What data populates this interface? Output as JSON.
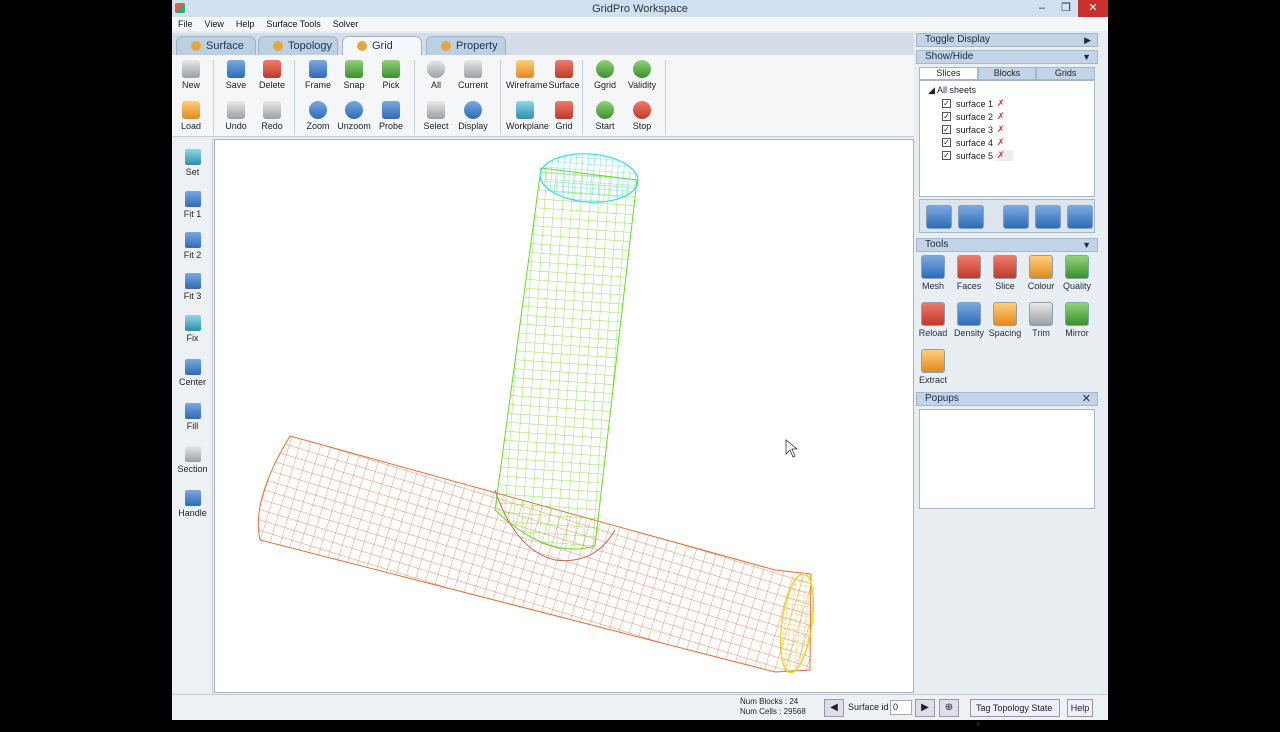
{
  "window": {
    "title": "GridPro Workspace"
  },
  "menubar": [
    "File",
    "View",
    "Help",
    "Surface Tools",
    "Solver"
  ],
  "tabs": [
    "Surface",
    "Topology",
    "Grid",
    "Property"
  ],
  "ribbon": {
    "new": "New",
    "save": "Save",
    "delete": "Delete",
    "frame": "Frame",
    "snap": "Snap",
    "pick": "Pick",
    "all": "All",
    "current": "Current",
    "wireframe": "Wireframe",
    "surface": "Surface",
    "ggrid": "Ggrid",
    "validity": "Validity",
    "load": "Load",
    "undo": "Undo",
    "redo": "Redo",
    "zoom": "Zoom",
    "unzoom": "Unzoom",
    "probe": "Probe",
    "select": "Select",
    "display": "Display",
    "workplane": "Workplane",
    "grid": "Grid",
    "start": "Start",
    "stop": "Stop"
  },
  "lefttools": [
    "Set",
    "Fit 1",
    "Fit 2",
    "Fit 3",
    "Fix",
    "Center",
    "Fill",
    "Section",
    "Handle"
  ],
  "rpanel": {
    "toggle_display": "Toggle Display",
    "show_hide": "Show/Hide",
    "subtabs": [
      "Slices",
      "Blocks",
      "Grids"
    ],
    "tree_root": "All sheets",
    "sheets": [
      "surface 1",
      "surface 2",
      "surface 3",
      "surface 4",
      "surface 5"
    ],
    "tools_header": "Tools",
    "tools": [
      "Mesh",
      "Faces",
      "Slice",
      "Colour",
      "Quality",
      "Reload",
      "Density",
      "Spacing",
      "Trim",
      "Mirror",
      "Extract"
    ],
    "popups_header": "Popups"
  },
  "status": {
    "num_blocks_label": "Num Blocks :",
    "num_blocks": "24",
    "num_cells_label": "Num Cells :",
    "num_cells": "29568",
    "surface_id_label": "Surface id :",
    "surface_id": "0",
    "tag_topology": "Tag Topology State",
    "help": "Help"
  },
  "colors": {
    "mesh_orange": "#e0703a",
    "mesh_green": "#66dd22",
    "cap_cyan": "#33ddee",
    "cap_yellow": "#f2d21a"
  }
}
